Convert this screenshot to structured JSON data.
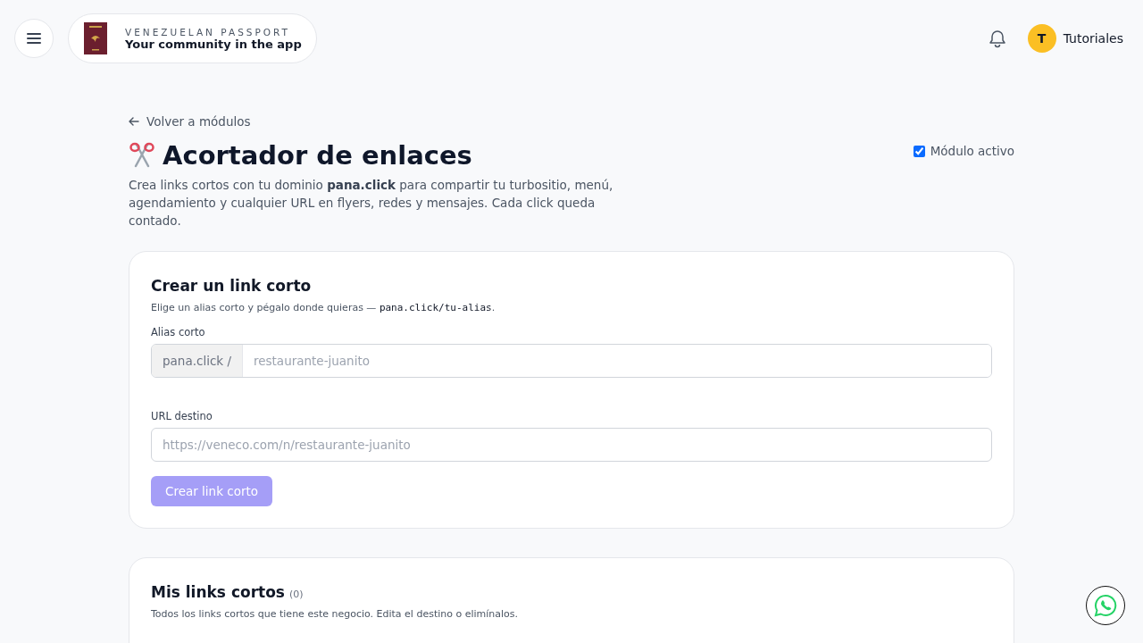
{
  "header": {
    "brand_overline": "VENEZUELAN PASSPORT",
    "brand_tagline": "Your community in the app",
    "user": {
      "initial": "T",
      "name": "Tutoriales"
    }
  },
  "page": {
    "back_link": "Volver a módulos",
    "title": "Acortador de enlaces",
    "module_toggle": {
      "label": "Módulo activo",
      "checked": true
    },
    "description": "Crea links cortos con tu dominio **pana.click** para compartir tu turbositio, menú, agendamiento y cualquier URL en flyers, redes y mensajes. Cada click queda contado."
  },
  "create_card": {
    "title": "Crear un link corto",
    "hint": {
      "text": "Elige un alias corto y pégalo donde quieras — ",
      "code": "pana.click/tu-alias",
      "end": "."
    },
    "alias_field": {
      "label": "Alias corto",
      "prefix": "pana.click /",
      "placeholder": "restaurante-juanito"
    },
    "url_field": {
      "label": "URL destino",
      "placeholder": "https://veneco.com/n/restaurante-juanito"
    },
    "submit": {
      "label": "Crear link corto",
      "disabled": true
    }
  },
  "links_card": {
    "title": "Mis links cortos",
    "count": "(0)",
    "subtitle": "Todos los links cortos que tiene este negocio. Edita el destino o elimínalos."
  }
}
